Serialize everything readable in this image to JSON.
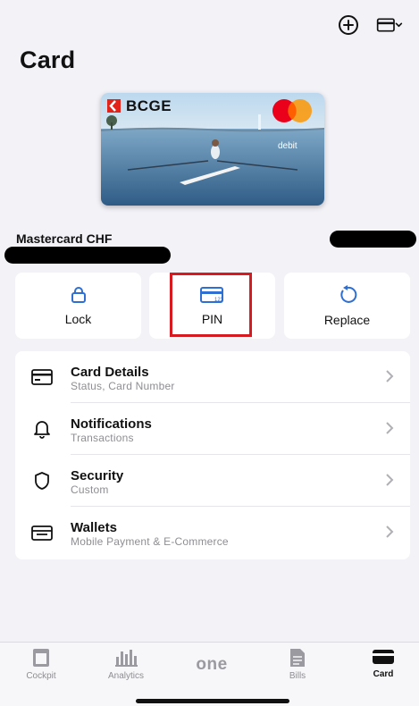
{
  "header": {
    "title": "Card",
    "add_icon": "plus-circle-icon",
    "card_switch_icon": "card-chevron-icon"
  },
  "card": {
    "bank_name": "BCGE",
    "type_label": "debit",
    "brand": "Mastercard",
    "name": "Mastercard CHF"
  },
  "actions": [
    {
      "label": "Lock",
      "icon": "lock-icon"
    },
    {
      "label": "PIN",
      "icon": "pin-card-icon"
    },
    {
      "label": "Replace",
      "icon": "replace-icon"
    }
  ],
  "menu": [
    {
      "title": "Card Details",
      "subtitle": "Status, Card Number",
      "icon": "card-details-icon"
    },
    {
      "title": "Notifications",
      "subtitle": "Transactions",
      "icon": "bell-icon"
    },
    {
      "title": "Security",
      "subtitle": "Custom",
      "icon": "shield-icon"
    },
    {
      "title": "Wallets",
      "subtitle": "Mobile Payment & E-Commerce",
      "icon": "wallet-icon"
    }
  ],
  "tabs": [
    {
      "label": "Cockpit",
      "icon": "cockpit-icon"
    },
    {
      "label": "Analytics",
      "icon": "analytics-icon"
    },
    {
      "label": "one",
      "icon": "one-logo"
    },
    {
      "label": "Bills",
      "icon": "bills-icon"
    },
    {
      "label": "Card",
      "icon": "card-tab-icon",
      "active": true
    }
  ],
  "colors": {
    "accent_blue": "#2f6fd1",
    "highlight_red": "#d71920",
    "background": "#f2f2f7"
  }
}
